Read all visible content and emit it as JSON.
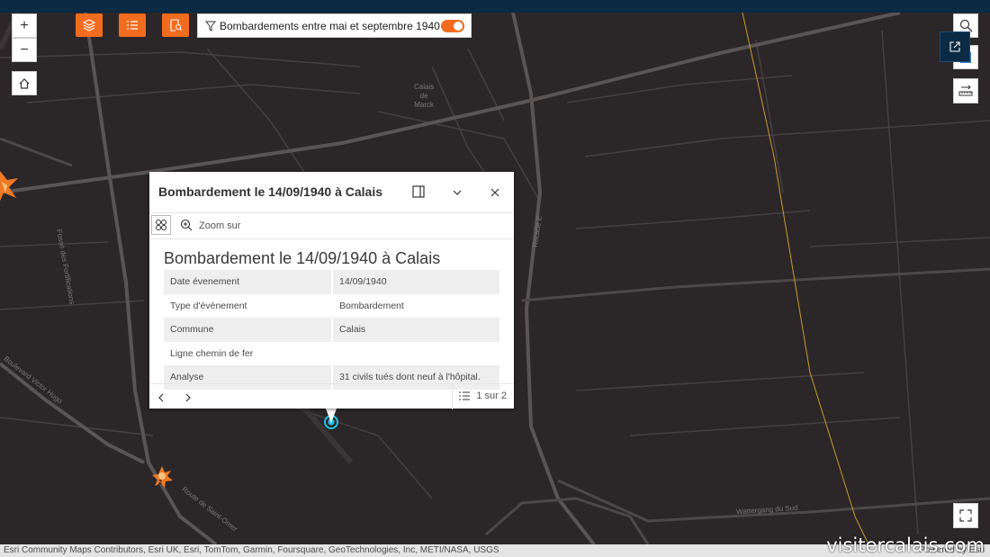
{
  "filter": {
    "label": "Bombardements entre mai et septembre 1940",
    "enabled": true
  },
  "map_labels": {
    "calais_de_marck": [
      "Calais",
      "de",
      "Marck"
    ],
    "fosse": "Fossé des Fortifications",
    "boulevard": "Boulevard Victor Hugo",
    "route": "Route de Saint-Omer",
    "rocade": "Rocade E",
    "wattergang": "Wattergang du Sud"
  },
  "cluster_badge": "2",
  "popup": {
    "header_title": "Bombardement le 14/09/1940 à Calais",
    "zoom_label": "Zoom sur",
    "feature_title": "Bombardement le 14/09/1940 à Calais",
    "rows": [
      {
        "label": "Date évenement",
        "value": "14/09/1940"
      },
      {
        "label": "Type d'évènement",
        "value": "Bombardement"
      },
      {
        "label": "Commune",
        "value": "Calais"
      },
      {
        "label": "Ligne chemin de fer",
        "value": ""
      },
      {
        "label": "Analyse",
        "value": "31 civils tués dont neuf à l'hôpital."
      }
    ],
    "pager": "1 sur 2"
  },
  "attribution": "Esri Community Maps Contributors, Esri UK, Esri, TomTom, Garmin, Foursquare, GeoTechnologies, Inc, METI/NASA, USGS",
  "powered_by": "Powered by Esri",
  "watermark": "visitercalais.com",
  "colors": {
    "accent": "#f26c1f",
    "header": "#0b2a44",
    "basemap": "#2b2728"
  }
}
